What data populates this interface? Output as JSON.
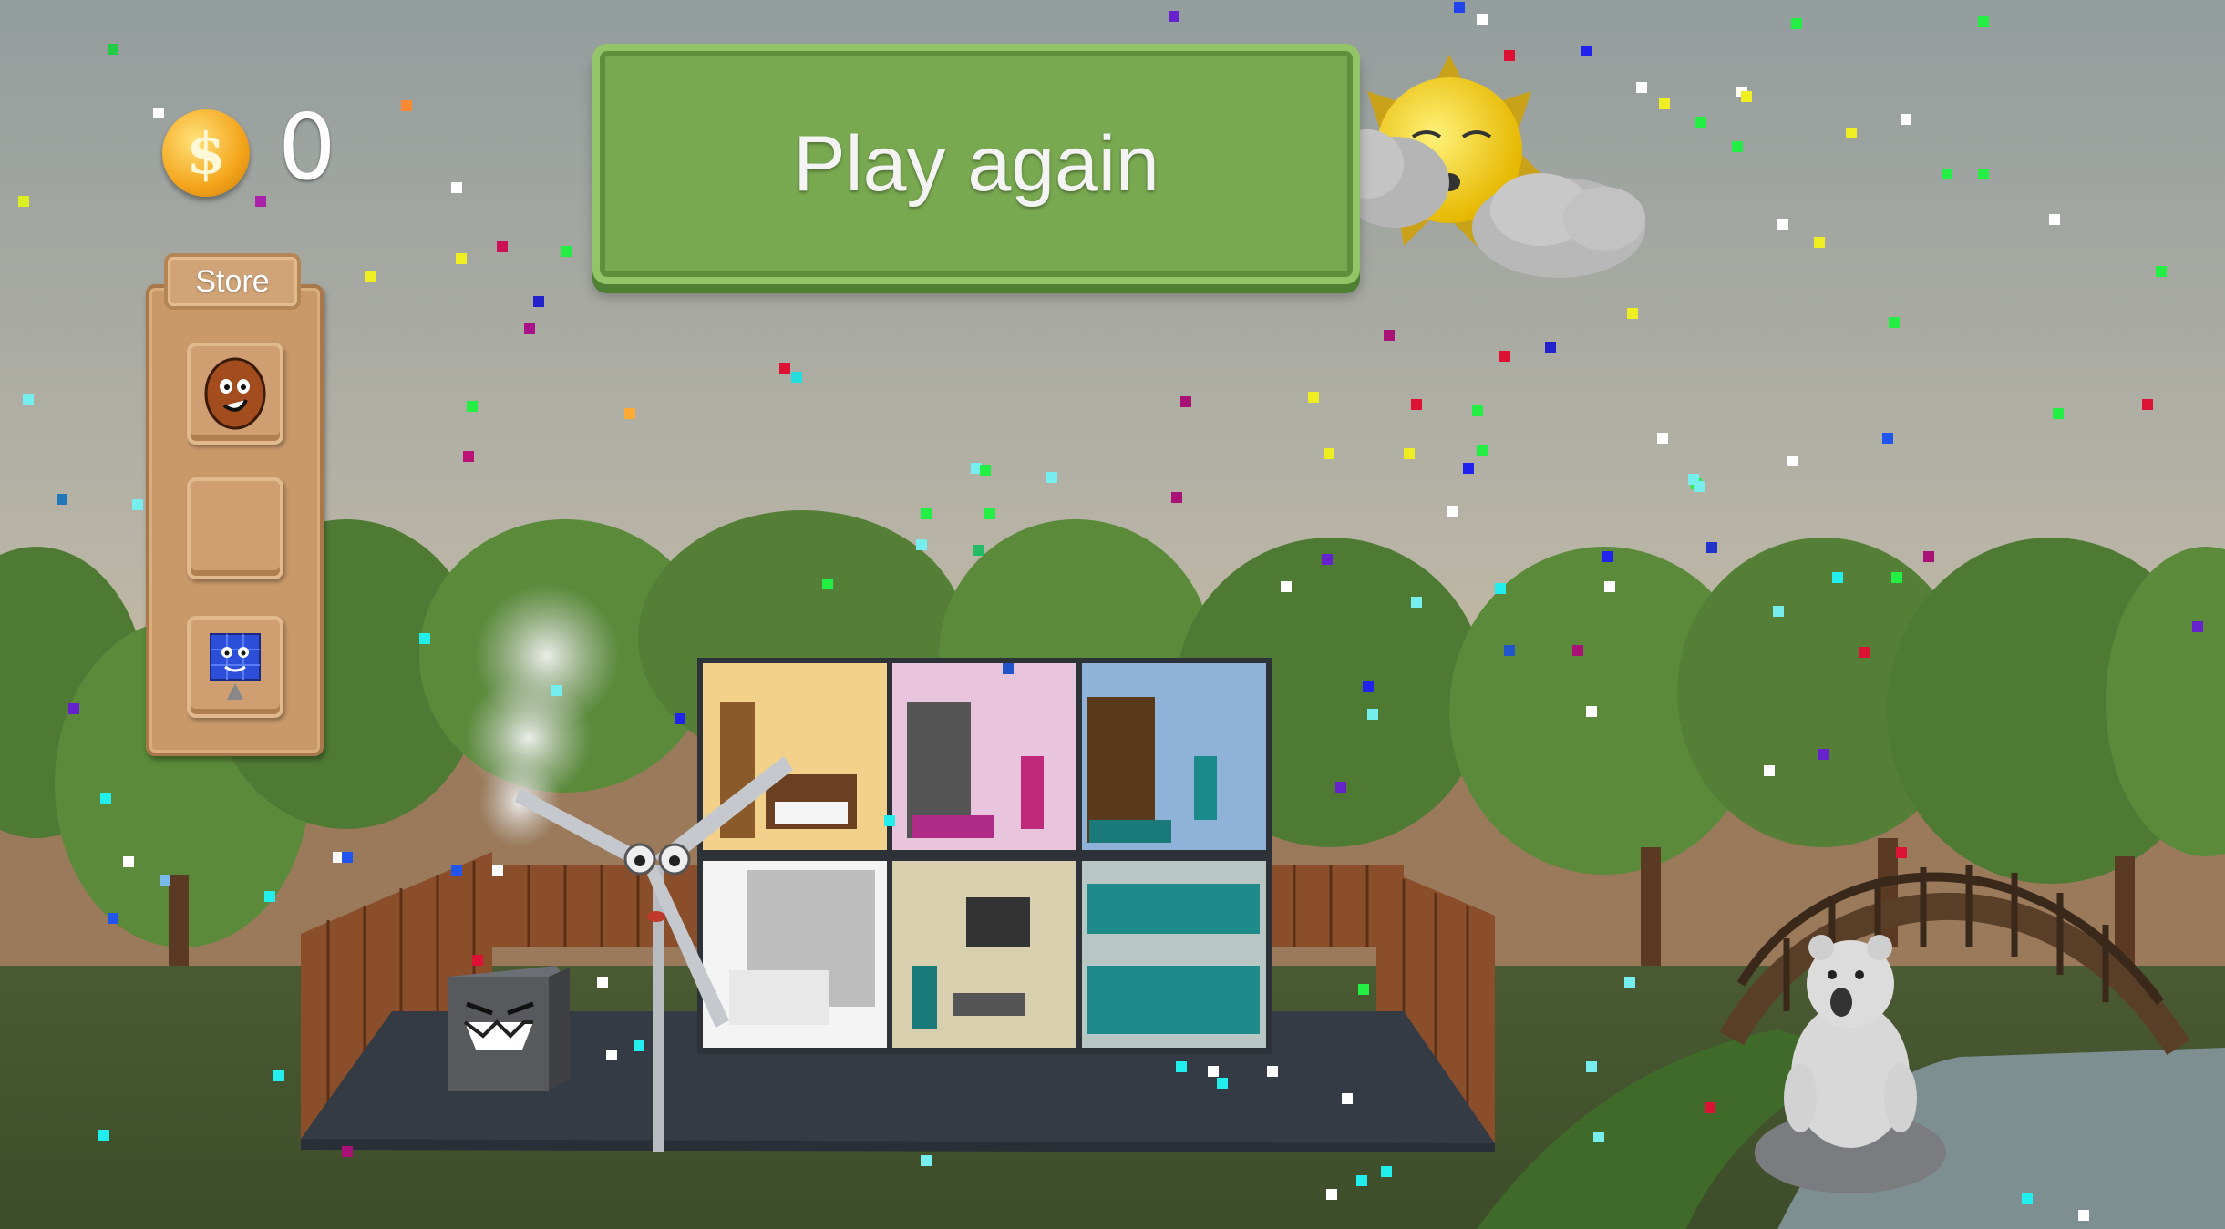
{
  "hud": {
    "coin_count": "0",
    "coin_icon": "gold-dollar-coin",
    "coin_symbol": "$"
  },
  "store": {
    "title": "Store",
    "items": [
      {
        "name": "coal-character",
        "icon": "coal-face-icon"
      },
      {
        "name": "empty-slot",
        "icon": ""
      },
      {
        "name": "solar-panel-character",
        "icon": "solar-panel-icon"
      }
    ]
  },
  "play_again": {
    "label": "Play again"
  },
  "colors": {
    "button_green": "#78a850",
    "panel_brown": "#c9996a",
    "coin_gold": "#f4a51c",
    "sky_top": "#9ea8a6",
    "sky_horizon": "#e2c590"
  }
}
